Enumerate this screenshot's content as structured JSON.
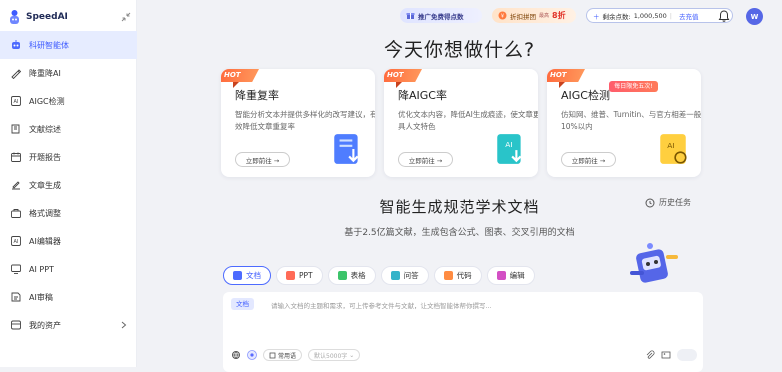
{
  "app": {
    "name": "SpeedAI"
  },
  "sidebar": {
    "items": [
      {
        "label": "科研智能体",
        "icon": "robot-icon",
        "active": true
      },
      {
        "label": "降重降AI",
        "icon": "pen-icon"
      },
      {
        "label": "AIGC检测",
        "icon": "aigc-icon"
      },
      {
        "label": "文献综述",
        "icon": "book-icon"
      },
      {
        "label": "开题报告",
        "icon": "calendar-icon"
      },
      {
        "label": "文章生成",
        "icon": "edit-icon"
      },
      {
        "label": "格式调整",
        "icon": "briefcase-icon"
      },
      {
        "label": "AI编辑器",
        "icon": "ai-box-icon"
      },
      {
        "label": "AI PPT",
        "icon": "monitor-icon"
      },
      {
        "label": "AI审稿",
        "icon": "review-icon"
      },
      {
        "label": "我的资产",
        "icon": "assets-icon"
      }
    ]
  },
  "topbar": {
    "promo": "推广免费得点数",
    "promo2_text": "折扣拼团",
    "promo2_small": "最高",
    "promo2_big": "8折",
    "points_label": "剩余点数:",
    "points_value": "1,000,500",
    "recharge": "去充值",
    "avatar": "W"
  },
  "headline": "今天你想做什么?",
  "cards": [
    {
      "hot": "HOT",
      "title": "降重复率",
      "desc": "智能分析文本并提供多样化的改写建议，有效降低文章重复率",
      "button": "立即前往 →"
    },
    {
      "hot": "HOT",
      "title": "降AIGC率",
      "desc": "优化文本内容，降低AI生成痕迹，使文章更具人文特色",
      "button": "立即前往 →"
    },
    {
      "hot": "HOT",
      "title": "AIGC检测",
      "badge": "每日限免五次!",
      "desc": "仿知网、维普、Turnitin、与官方相差一般10%以内",
      "button": "立即前往 →"
    }
  ],
  "section": {
    "title": "智能生成规范学术文档",
    "history": "历史任务",
    "subtitle": "基于2.5亿篇文献，生成包含公式、图表、交叉引用的文档"
  },
  "tabs": [
    {
      "label": "文档",
      "color": "#4d6bff",
      "active": true
    },
    {
      "label": "PPT",
      "color": "#ff6b57"
    },
    {
      "label": "表格",
      "color": "#3cc46a"
    },
    {
      "label": "问答",
      "color": "#35b3c9"
    },
    {
      "label": "代码",
      "color": "#ff8c42"
    },
    {
      "label": "编辑",
      "color": "#d34fc4"
    }
  ],
  "editor": {
    "tag": "文档",
    "placeholder": "请输入文档的主题和需求，可上传参考文件与文献，让文档智能体帮你撰写...",
    "chip1": "常用语",
    "chip2": "默认5000字"
  }
}
